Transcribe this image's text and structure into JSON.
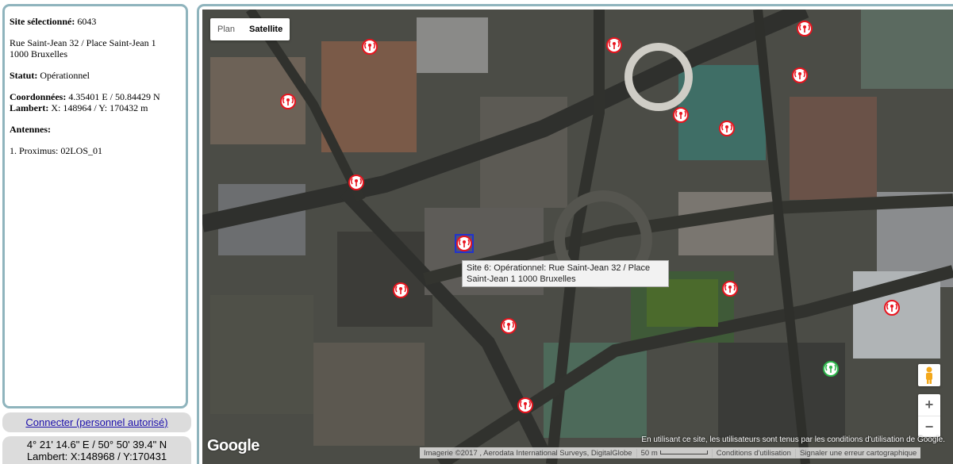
{
  "info": {
    "site_label": "Site sélectionné:",
    "site_id": "6043",
    "address_line1": "Rue Saint-Jean 32 / Place Saint-Jean 1",
    "address_line2": "1000 Bruxelles",
    "status_label": "Statut:",
    "status_value": "Opérationnel",
    "coords_label": "Coordonnées:",
    "coords_value": "4.35401 E / 50.84429 N",
    "lambert_label": "Lambert:",
    "lambert_value": "X: 148964 / Y: 170432 m",
    "antennas_label": "Antennes:",
    "antennas": [
      "1. Proximus: 02LOS_01"
    ]
  },
  "connect_link": "Connecter (personnel autorisé)",
  "cursor_coords": {
    "dms": "4° 21' 14.6\" E / 50° 50' 39.4\" N",
    "lambert": "Lambert: X:148968 / Y:170431"
  },
  "map": {
    "type_plan": "Plan",
    "type_satellite": "Satellite",
    "active_type": "Satellite",
    "tooltip": "Site 6: Opérationnel: Rue Saint-Jean 32 / Place Saint-Jean 1 1000 Bruxelles",
    "logo": "Google",
    "terms_notice": "En utilisant ce site, les utilisateurs sont tenus par les conditions d'utilisation de Google.",
    "imagery": "Imagerie ©2017 , Aerodata International Surveys, DigitalGlobe",
    "scale": "50 m",
    "terms_link": "Conditions d'utilisation",
    "report_link": "Signaler une erreur cartographique",
    "zoom_in": "+",
    "zoom_out": "−",
    "colors": {
      "antenna": "#e8141e",
      "selected": "#2233cc",
      "active_site": "#2bb54a"
    }
  }
}
